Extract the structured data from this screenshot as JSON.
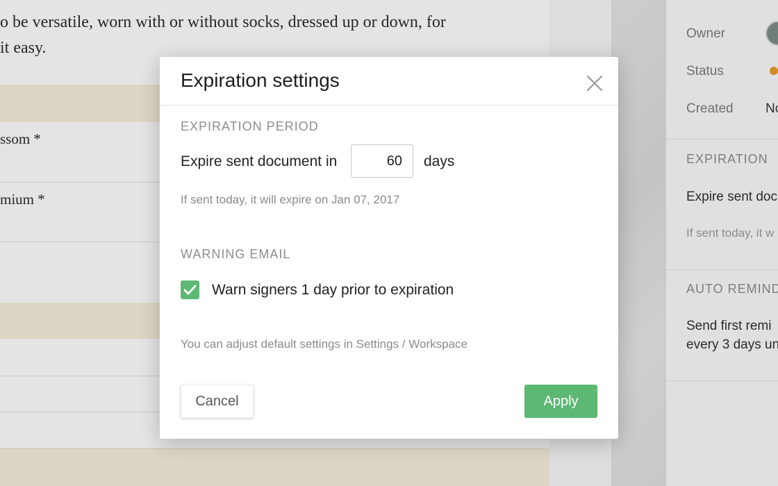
{
  "document": {
    "lines": [
      "o be versatile, worn with or without socks, dressed up or down, for",
      " it easy."
    ],
    "field_labels": [
      "ssom *",
      "mium *"
    ]
  },
  "sidebar": {
    "owner_label": "Owner",
    "status_label": "Status",
    "created_label": "Created",
    "created_value": "No",
    "expiration_heading": "EXPIRATION",
    "expiration_text": "Expire sent doc",
    "expiration_hint": "If sent today, it w",
    "reminders_heading": "AUTO REMINDE",
    "reminders_line1": "Send first remi",
    "reminders_line2": "every 3 days un",
    "status_color": "#e49a2c"
  },
  "modal": {
    "title": "Expiration settings",
    "close_icon": "close-icon",
    "expiration_period_heading": "EXPIRATION PERIOD",
    "expire_label": "Expire sent document in",
    "expire_days_value": "60",
    "days_label": "days",
    "expire_hint": "If sent today, it will expire on Jan 07, 2017",
    "warning_email_heading": "WARNING EMAIL",
    "warn_checked": true,
    "warn_label": "Warn signers 1 day prior to expiration",
    "settings_hint": "You can adjust default settings in Settings / Workspace",
    "cancel_label": "Cancel",
    "apply_label": "Apply",
    "accent_color": "#5cb873"
  }
}
